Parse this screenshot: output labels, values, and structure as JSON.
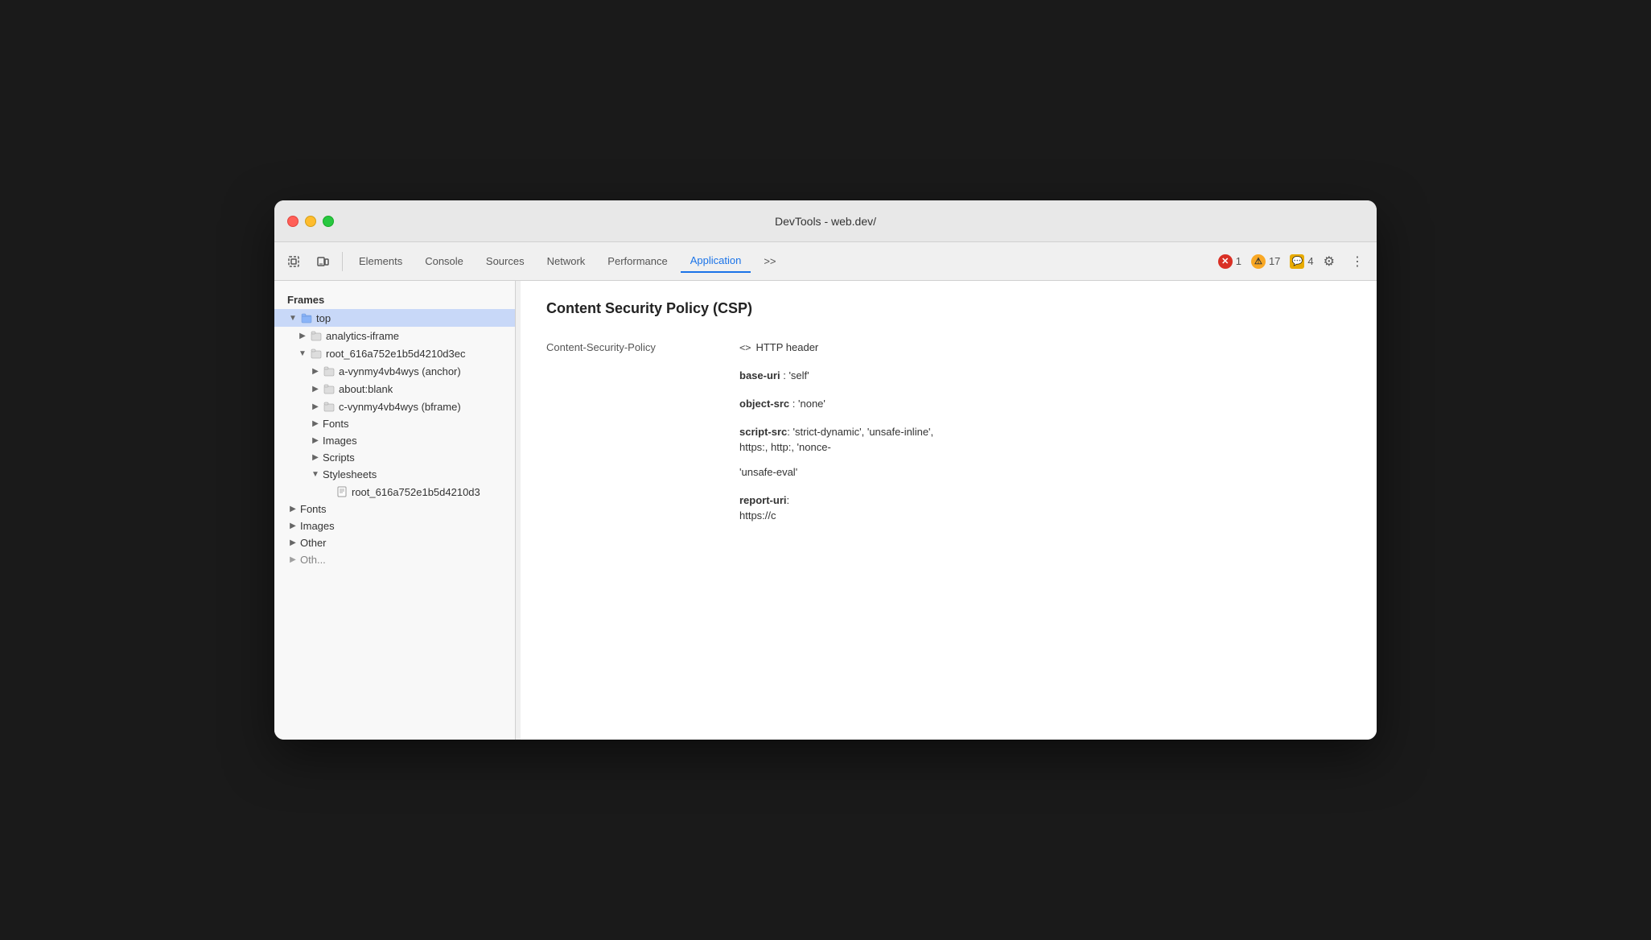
{
  "window": {
    "title": "DevTools - web.dev/"
  },
  "toolbar": {
    "inspect_label": "Inspect",
    "device_label": "Device",
    "tabs": [
      {
        "id": "elements",
        "label": "Elements",
        "active": false
      },
      {
        "id": "console",
        "label": "Console",
        "active": false
      },
      {
        "id": "sources",
        "label": "Sources",
        "active": false
      },
      {
        "id": "network",
        "label": "Network",
        "active": false
      },
      {
        "id": "performance",
        "label": "Performance",
        "active": false
      },
      {
        "id": "application",
        "label": "Application",
        "active": true
      }
    ],
    "more_label": ">>",
    "errors": {
      "error_count": "1",
      "warning_count": "17",
      "info_count": "4"
    }
  },
  "sidebar": {
    "section_title": "Frames",
    "items": [
      {
        "id": "top",
        "label": "top",
        "level": 0,
        "type": "folder",
        "expanded": true,
        "selected": true
      },
      {
        "id": "analytics-iframe",
        "label": "analytics-iframe",
        "level": 1,
        "type": "folder",
        "expanded": false
      },
      {
        "id": "root_frame",
        "label": "root_616a752e1b5d4210d3ec",
        "level": 1,
        "type": "folder",
        "expanded": true
      },
      {
        "id": "a-anchor",
        "label": "a-vynmy4vb4wys (anchor)",
        "level": 2,
        "type": "folder",
        "expanded": false
      },
      {
        "id": "about-blank",
        "label": "about:blank",
        "level": 2,
        "type": "folder",
        "expanded": false
      },
      {
        "id": "c-bframe",
        "label": "c-vynmy4vb4wys (bframe)",
        "level": 2,
        "type": "folder",
        "expanded": false
      },
      {
        "id": "fonts-child",
        "label": "Fonts",
        "level": 2,
        "type": "folder-plain",
        "expanded": false
      },
      {
        "id": "images-child",
        "label": "Images",
        "level": 2,
        "type": "folder-plain",
        "expanded": false
      },
      {
        "id": "scripts-child",
        "label": "Scripts",
        "level": 2,
        "type": "folder-plain",
        "expanded": false
      },
      {
        "id": "stylesheets-child",
        "label": "Stylesheets",
        "level": 2,
        "type": "folder-plain",
        "expanded": true
      },
      {
        "id": "stylesheet-file",
        "label": "root_616a752e1b5d4210d3",
        "level": 3,
        "type": "file"
      },
      {
        "id": "fonts-top",
        "label": "Fonts",
        "level": 0,
        "type": "folder-plain",
        "expanded": false
      },
      {
        "id": "images-top",
        "label": "Images",
        "level": 0,
        "type": "folder-plain",
        "expanded": false
      },
      {
        "id": "other-top",
        "label": "Other",
        "level": 0,
        "type": "folder-plain",
        "expanded": false
      },
      {
        "id": "other2-top",
        "label": "Oth...",
        "level": 0,
        "type": "folder-plain",
        "expanded": false
      }
    ]
  },
  "main": {
    "csp_title": "Content Security Policy (CSP)",
    "csp_key": "Content-Security-Policy",
    "csp_header_icon": "<>",
    "csp_header_type": "HTTP header",
    "csp_entries": [
      {
        "key": "base-uri",
        "value": "'self'"
      },
      {
        "key": "object-src",
        "value": "'none'"
      },
      {
        "key": "script-src",
        "value": "'strict-dynamic', 'unsafe-inline',"
      },
      {
        "key": "",
        "value": "https:, http:, 'nonce-"
      },
      {
        "key": "",
        "value": "'unsafe-eval'"
      },
      {
        "key": "report-uri",
        "value": ""
      },
      {
        "key": "",
        "value": "https://c"
      }
    ]
  }
}
